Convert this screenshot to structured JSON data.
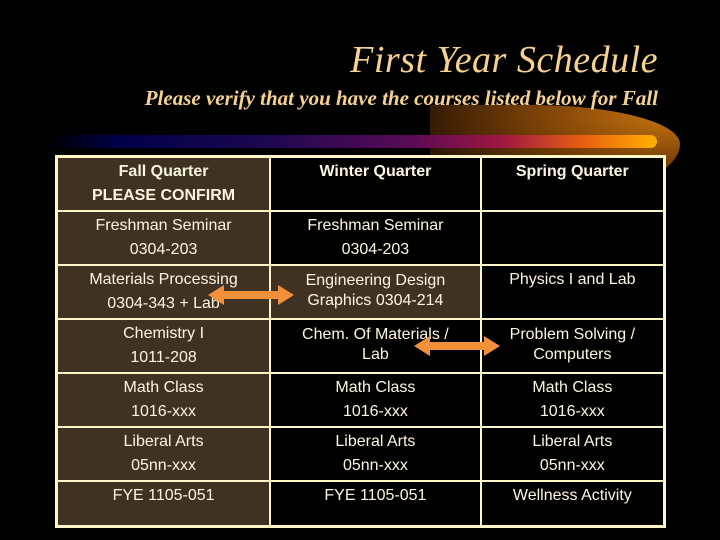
{
  "slide": {
    "title": "First Year Schedule",
    "subtitle": "Please verify that you have the courses listed below for Fall"
  },
  "table": {
    "headers": [
      {
        "line1": "Fall Quarter",
        "line2": "PLEASE CONFIRM"
      },
      {
        "line1": "Winter Quarter",
        "line2": ""
      },
      {
        "line1": "Spring Quarter",
        "line2": ""
      }
    ],
    "rows": [
      [
        {
          "line1": "Freshman Seminar",
          "line2": "0304-203"
        },
        {
          "line1": "Freshman Seminar",
          "line2": "0304-203"
        },
        {
          "line1": "",
          "line2": ""
        }
      ],
      [
        {
          "line1": "Materials Processing",
          "line2": "0304-343 + Lab"
        },
        {
          "line1": "Engineering Design",
          "line2": "Graphics 0304-214"
        },
        {
          "line1": "Physics I and Lab",
          "line2": ""
        }
      ],
      [
        {
          "line1": "Chemistry I",
          "line2": "1011-208"
        },
        {
          "line1": "Chem. Of Materials /",
          "line2": "Lab"
        },
        {
          "line1": "Problem Solving /",
          "line2": "Computers"
        }
      ],
      [
        {
          "line1": "Math Class",
          "line2": "1016-xxx"
        },
        {
          "line1": "Math Class",
          "line2": "1016-xxx"
        },
        {
          "line1": "Math Class",
          "line2": "1016-xxx"
        }
      ],
      [
        {
          "line1": "Liberal Arts",
          "line2": "05nn-xxx"
        },
        {
          "line1": "Liberal Arts",
          "line2": "05nn-xxx"
        },
        {
          "line1": "Liberal Arts",
          "line2": "05nn-xxx"
        }
      ],
      [
        {
          "line1": "FYE 1105-051",
          "line2": ""
        },
        {
          "line1": "FYE 1105-051",
          "line2": ""
        },
        {
          "line1": "Wellness Activity",
          "line2": ""
        }
      ]
    ]
  },
  "icons": {
    "arrow1": "double-headed-arrow",
    "arrow2": "double-headed-arrow"
  },
  "colors": {
    "title": "#f7d18f",
    "fall_column_bg": "#3f3222",
    "grid": "#fff6c8",
    "arrow": "#f2913a"
  }
}
